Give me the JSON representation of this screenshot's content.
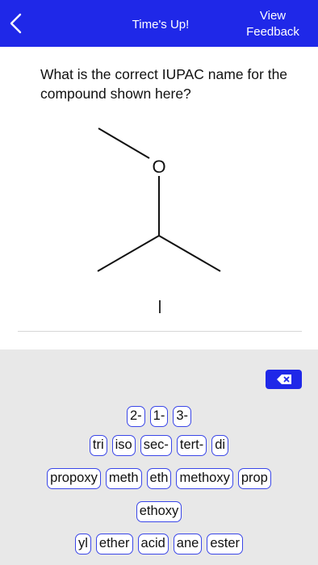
{
  "header": {
    "title": "Time's Up!",
    "feedback_label": "View Feedback"
  },
  "question": {
    "text": "What is the correct IUPAC name for the compound shown here?",
    "atom_label": "O"
  },
  "answer": {
    "current_value": ""
  },
  "colors": {
    "accent": "#1f28e8",
    "key_border": "#3a46e8",
    "keyboard_bg": "#e8e8e8"
  },
  "keyboard": {
    "backspace_icon": "backspace-icon",
    "row1": [
      "2-",
      "1-",
      "3-"
    ],
    "row2": [
      "tri",
      "iso",
      "sec-",
      "tert-",
      "di"
    ],
    "row3": [
      "propoxy",
      "meth",
      "eth",
      "methoxy",
      "prop"
    ],
    "row4": [
      "ethoxy"
    ],
    "row5": [
      "yl",
      "ether",
      "acid",
      "ane",
      "ester"
    ]
  }
}
